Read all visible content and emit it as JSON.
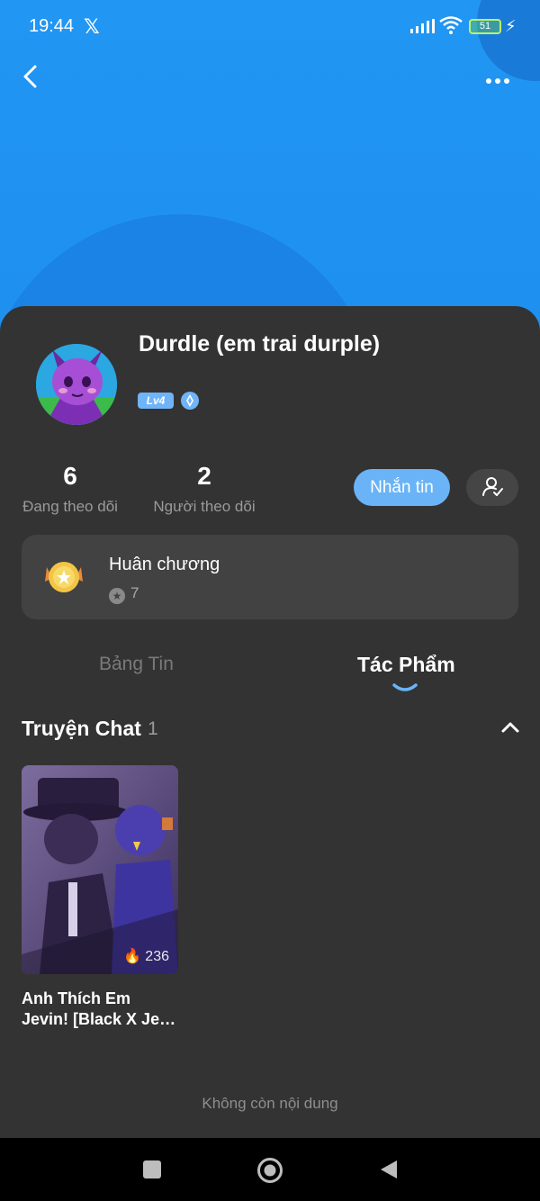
{
  "status_bar": {
    "time": "19:44",
    "battery": "51",
    "icons": [
      "x-logo-icon",
      "signal-icon",
      "wifi-icon",
      "battery-icon",
      "charging-bolt-icon"
    ]
  },
  "header": {
    "back_icon": "chevron-left-icon",
    "more_icon": "more-dots-icon"
  },
  "profile": {
    "name": "Durdle (em trai durple)",
    "level": "Lv4",
    "verified_icon": "diamond-badge-icon",
    "stats": [
      {
        "value": "6",
        "label": "Đang theo dõi"
      },
      {
        "value": "2",
        "label": "Người theo dõi"
      }
    ],
    "message_label": "Nhắn tin",
    "follow_icon": "user-check-icon",
    "accent_color": "#6ab3f7"
  },
  "medals": {
    "title": "Huân chương",
    "count": "7"
  },
  "tabs": [
    {
      "label": "Bảng Tin",
      "active": false
    },
    {
      "label": "Tác Phẩm",
      "active": true
    }
  ],
  "section": {
    "title": "Truyện Chat",
    "count": "1"
  },
  "stories": [
    {
      "title": "Anh Thích Em Jevin! [Black X Je…",
      "views": "236"
    }
  ],
  "end_message": "Không còn nội dung"
}
